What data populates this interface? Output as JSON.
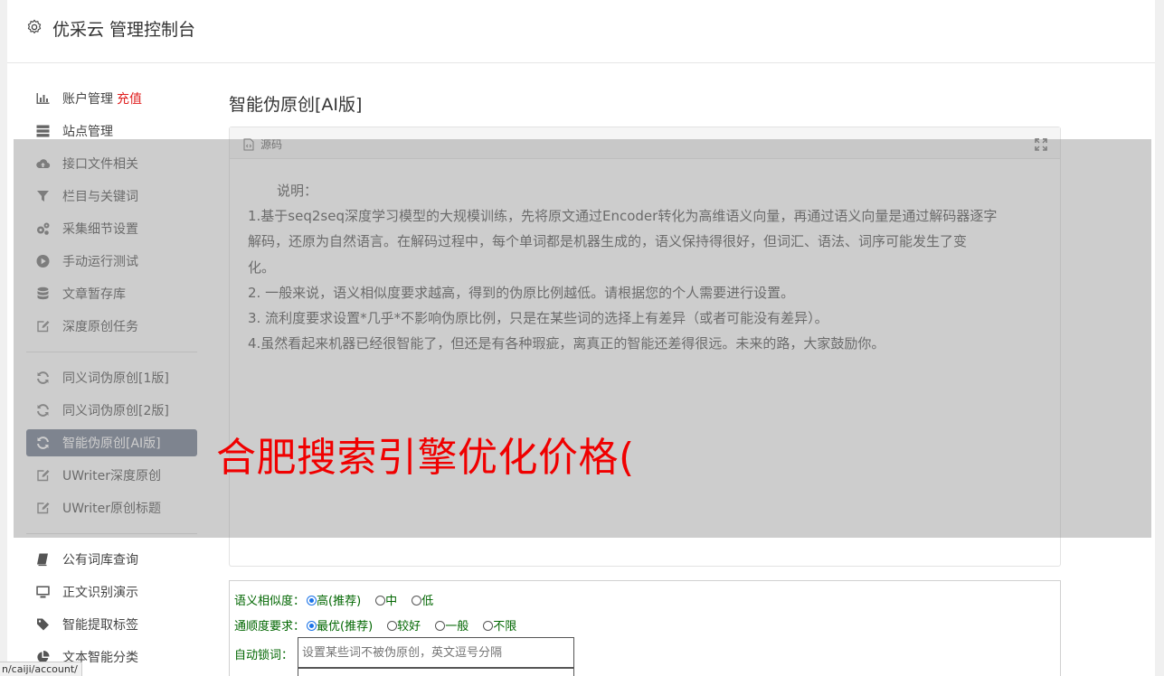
{
  "header": {
    "title": "优采云 管理控制台"
  },
  "sidebar": {
    "items": [
      {
        "label": "账户管理",
        "extra": "充值",
        "icon": "bar-chart-icon"
      },
      {
        "label": "站点管理",
        "icon": "server-icon"
      },
      {
        "label": "接口文件相关",
        "icon": "cloud-upload-icon"
      },
      {
        "label": "栏目与关键词",
        "icon": "filter-icon"
      },
      {
        "label": "采集细节设置",
        "icon": "gears-icon"
      },
      {
        "label": "手动运行测试",
        "icon": "play-circle-icon"
      },
      {
        "label": "文章暂存库",
        "icon": "database-icon"
      },
      {
        "label": "深度原创任务",
        "icon": "edit-icon"
      },
      {
        "label": "同义词伪原创[1版]",
        "icon": "refresh-icon"
      },
      {
        "label": "同义词伪原创[2版]",
        "icon": "refresh-icon"
      },
      {
        "label": "智能伪原创[AI版]",
        "icon": "refresh-icon",
        "active": true
      },
      {
        "label": "UWriter深度原创",
        "icon": "edit-icon"
      },
      {
        "label": "UWriter原创标题",
        "icon": "edit-icon"
      },
      {
        "label": "公有词库查询",
        "icon": "book-icon"
      },
      {
        "label": "正文识别演示",
        "icon": "monitor-icon"
      },
      {
        "label": "智能提取标签",
        "icon": "tag-icon"
      },
      {
        "label": "文本智能分类",
        "icon": "pie-chart-icon"
      }
    ]
  },
  "main": {
    "title": "智能伪原创[AI版]",
    "editor": {
      "header_label": "源码",
      "lines": [
        "说明：",
        "1.基于seq2seq深度学习模型的大规模训练，先将原文通过Encoder转化为高维语义向量，再通过语义向量是通过解码器逐字",
        "解码，还原为自然语言。在解码过程中，每个单词都是机器生成的，语义保持得很好，但词汇、语法、词序可能发生了变",
        "化。",
        "2. 一般来说，语义相似度要求越高，得到的伪原比例越低。请根据您的个人需要进行设置。",
        "3. 流利度要求设置*几乎*不影响伪原比例，只是在某些词的选择上有差异（或者可能没有差异）。",
        "4.虽然看起来机器已经很智能了，但还是有各种瑕疵，离真正的智能还差得很远。未来的路，大家鼓励你。"
      ]
    },
    "options": {
      "similarity": {
        "label": "语义相似度：",
        "choices": [
          "高(推荐)",
          "中",
          "低"
        ],
        "selected": "高(推荐)"
      },
      "fluency": {
        "label": "通顺度要求：",
        "choices": [
          "最优(推荐)",
          "较好",
          "一般",
          "不限"
        ],
        "selected": "最优(推荐)"
      },
      "lock": {
        "label": "自动锁词：",
        "placeholder": "设置某些词不被伪原创，英文逗号分隔"
      }
    }
  },
  "watermark": "合肥搜索引擎优化价格(",
  "status_url": "n/caiji/account/",
  "colors": {
    "active_nav": "#687388",
    "recharge": "#e02020",
    "watermark": "#f00000",
    "option_text": "#006600"
  }
}
